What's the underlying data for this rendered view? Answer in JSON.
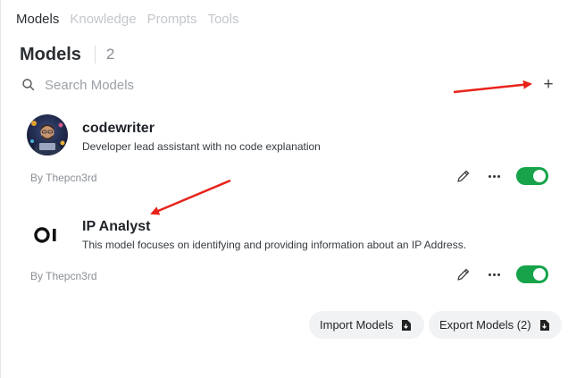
{
  "tabs": [
    {
      "label": "Models",
      "active": true
    },
    {
      "label": "Knowledge",
      "active": false
    },
    {
      "label": "Prompts",
      "active": false
    },
    {
      "label": "Tools",
      "active": false
    }
  ],
  "header": {
    "title": "Models",
    "count": "2"
  },
  "search": {
    "placeholder": "Search Models",
    "icon": "search-icon"
  },
  "add_button": {
    "label": "+"
  },
  "models": [
    {
      "name": "codewriter",
      "description": "Developer lead assistant with no code explanation",
      "author": "By Thepcn3rd",
      "avatar": "developer-avatar",
      "enabled": true
    },
    {
      "name": "IP Analyst",
      "description": "This model focuses on identifying and providing information about an IP Address.",
      "author": "By Thepcn3rd",
      "avatar": "OI",
      "enabled": true
    }
  ],
  "footer": {
    "import_label": "Import Models",
    "export_label": "Export Models (2)"
  },
  "colors": {
    "toggle_on": "#16a34a",
    "annotation_arrow": "#e8231a",
    "muted_tab": "#c4c7cc"
  }
}
